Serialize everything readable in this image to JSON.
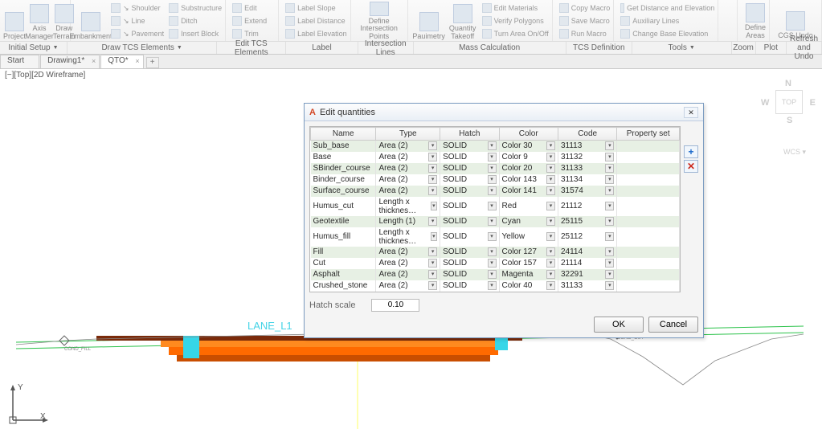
{
  "ribbon": {
    "large": {
      "project": "Project",
      "axis": "Axis Manager",
      "terrain": "Draw Terrain",
      "embankment": "Embankment",
      "planimetry": "Pauimetry",
      "quantity": "Quantity Takeoff",
      "define": "Define Intersection Points",
      "defareas": "Define Areas",
      "cgsundo": "CGS Undo"
    },
    "small": {
      "shoulder": "Shoulder",
      "substructure": "Substructure",
      "line": "Line",
      "ditch": "Ditch",
      "pavement": "Pavement",
      "insertblock": "Insert Block",
      "edit": "Edit",
      "extend": "Extend",
      "trim": "Trim",
      "labelslope": "Label Slope",
      "labeldistance": "Label Distance",
      "labelelevation": "Label Elevation",
      "editmaterials": "Edit Materials",
      "verifypolygons": "Verify Polygons",
      "turnarea": "Turn Area On/Off",
      "copymacro": "Copy Macro",
      "savemacro": "Save Macro",
      "runmacro": "Run Macro",
      "getdist": "Get Distance and Elevation",
      "auxlines": "Auxiliary Lines",
      "changebase": "Change Base Elevation"
    }
  },
  "panels": {
    "initial": "Initial Setup",
    "drawtcs": "Draw TCS Elements",
    "edittcs": "Edit TCS Elements",
    "label": "Label",
    "intersection": "Intersection Lines",
    "mass": "Mass Calculation",
    "tcsdef": "TCS Definition",
    "tools": "Tools",
    "zoom": "Zoom",
    "plot": "Plot",
    "refresh": "Refresh and Undo"
  },
  "tabs": {
    "t0": "Start",
    "t1": "Drawing1*",
    "t2": "QTO*"
  },
  "viewport_label": "[−][Top][2D Wireframe]",
  "viewcube": {
    "top": "TOP",
    "n": "N",
    "s": "S",
    "e": "E",
    "w": "W",
    "wcs": "WCS"
  },
  "axis": {
    "x": "X",
    "y": "Y"
  },
  "lanes": {
    "l": "LANE_L1",
    "r": "LANE_R1"
  },
  "dialog": {
    "title": "Edit quantities",
    "headers": {
      "name": "Name",
      "type": "Type",
      "hatch": "Hatch",
      "color": "Color",
      "code": "Code",
      "pset": "Property set"
    },
    "rows": [
      {
        "name": "Sub_base",
        "type": "Area (2)",
        "hatch": "SOLID",
        "color": "Color 30",
        "code": "31113"
      },
      {
        "name": "Base",
        "type": "Area (2)",
        "hatch": "SOLID",
        "color": "Color 9",
        "code": "31132"
      },
      {
        "name": "SBinder_course",
        "type": "Area (2)",
        "hatch": "SOLID",
        "color": "Color 20",
        "code": "31133"
      },
      {
        "name": "Binder_course",
        "type": "Area (2)",
        "hatch": "SOLID",
        "color": "Color 143",
        "code": "31134"
      },
      {
        "name": "Surface_course",
        "type": "Area (2)",
        "hatch": "SOLID",
        "color": "Color 141",
        "code": "31574"
      },
      {
        "name": "Humus_cut",
        "type": "Length x thicknes…",
        "hatch": "SOLID",
        "color": "Red",
        "code": "21112"
      },
      {
        "name": "Geotextile",
        "type": "Length (1)",
        "hatch": "SOLID",
        "color": "Cyan",
        "code": "25115"
      },
      {
        "name": "Humus_fill",
        "type": "Length x thicknes…",
        "hatch": "SOLID",
        "color": "Yellow",
        "code": "25112"
      },
      {
        "name": "Fill",
        "type": "Area (2)",
        "hatch": "SOLID",
        "color": "Color 127",
        "code": "24114"
      },
      {
        "name": "Cut",
        "type": "Area (2)",
        "hatch": "SOLID",
        "color": "Color 157",
        "code": "21114"
      },
      {
        "name": "Asphalt",
        "type": "Area (2)",
        "hatch": "SOLID",
        "color": "Magenta",
        "code": "32291"
      },
      {
        "name": "Crushed_stone",
        "type": "Area (2)",
        "hatch": "SOLID",
        "color": "Color 40",
        "code": "31133"
      }
    ],
    "hatch_scale_label": "Hatch scale",
    "hatch_scale_value": "0.10",
    "ok": "OK",
    "cancel": "Cancel"
  }
}
